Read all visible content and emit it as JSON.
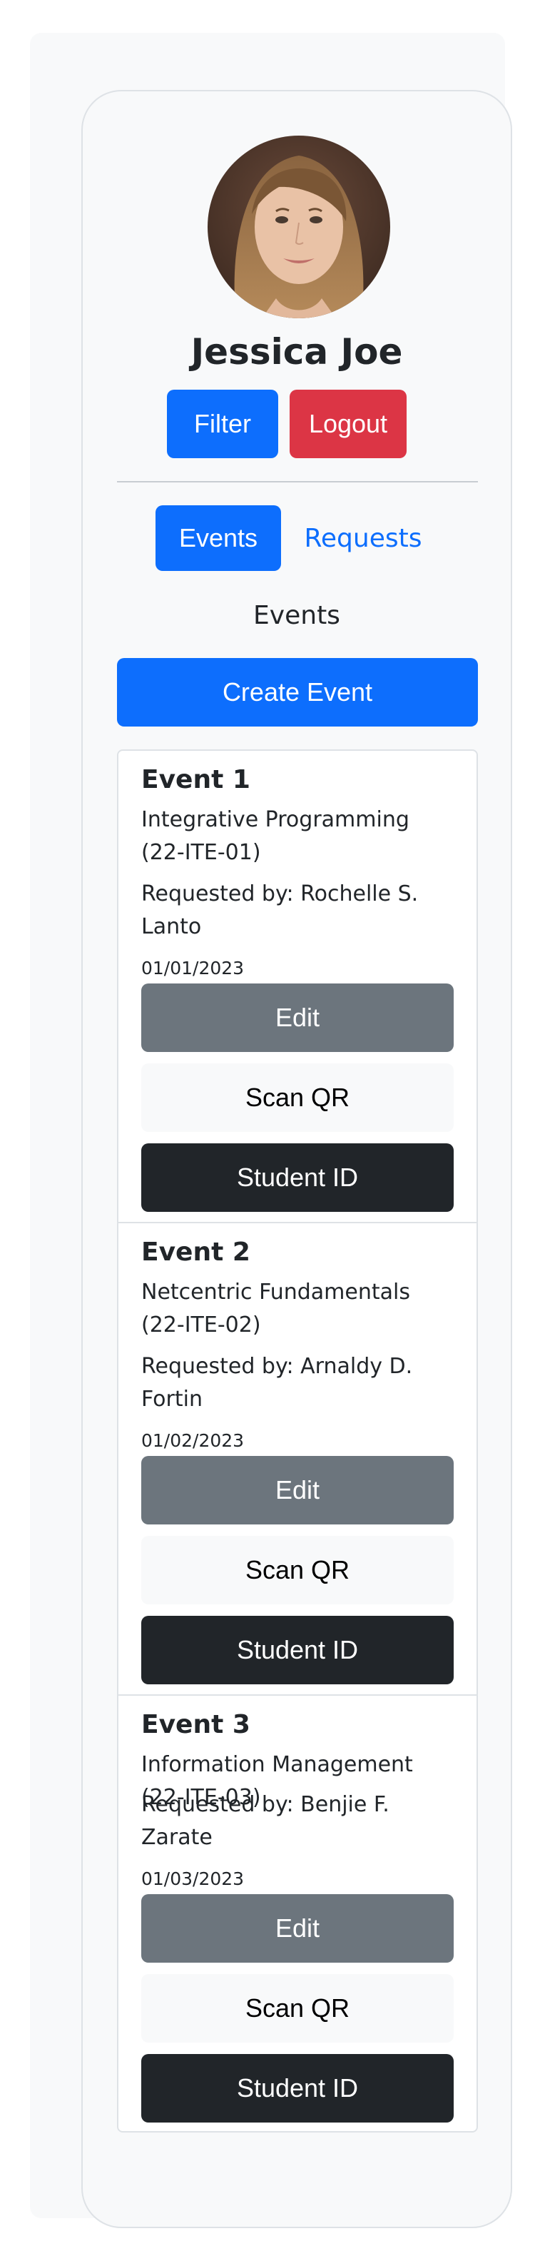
{
  "profile": {
    "name": "Jessica Joe"
  },
  "header_buttons": {
    "filter": "Filter",
    "logout": "Logout"
  },
  "tabs": [
    {
      "label": "Events",
      "active": true
    },
    {
      "label": "Requests",
      "active": false
    }
  ],
  "section_title": "Events",
  "create_button": "Create Event",
  "events": [
    {
      "title": "Event 1",
      "course": "Integrative Programming (22-ITE-01)",
      "requested_by": "Requested by: Rochelle S. Lanto",
      "date": "01/01/2023",
      "edit": "Edit",
      "scan": "Scan QR",
      "student": "Student ID"
    },
    {
      "title": "Event 2",
      "course": "Netcentric Fundamentals (22-ITE-02)",
      "requested_by": "Requested by: Arnaldy D. Fortin",
      "date": "01/02/2023",
      "edit": "Edit",
      "scan": "Scan QR",
      "student": "Student ID"
    },
    {
      "title": "Event 3",
      "course": "Information Management (22-ITE-03)",
      "requested_by": "Requested by: Benjie F. Zarate",
      "date": "01/03/2023",
      "edit": "Edit",
      "scan": "Scan QR",
      "student": "Student ID"
    }
  ],
  "colors": {
    "primary": "#0d6efd",
    "danger": "#dc3545",
    "secondary": "#6c757d",
    "dark": "#212529",
    "light": "#f8f9fa"
  }
}
